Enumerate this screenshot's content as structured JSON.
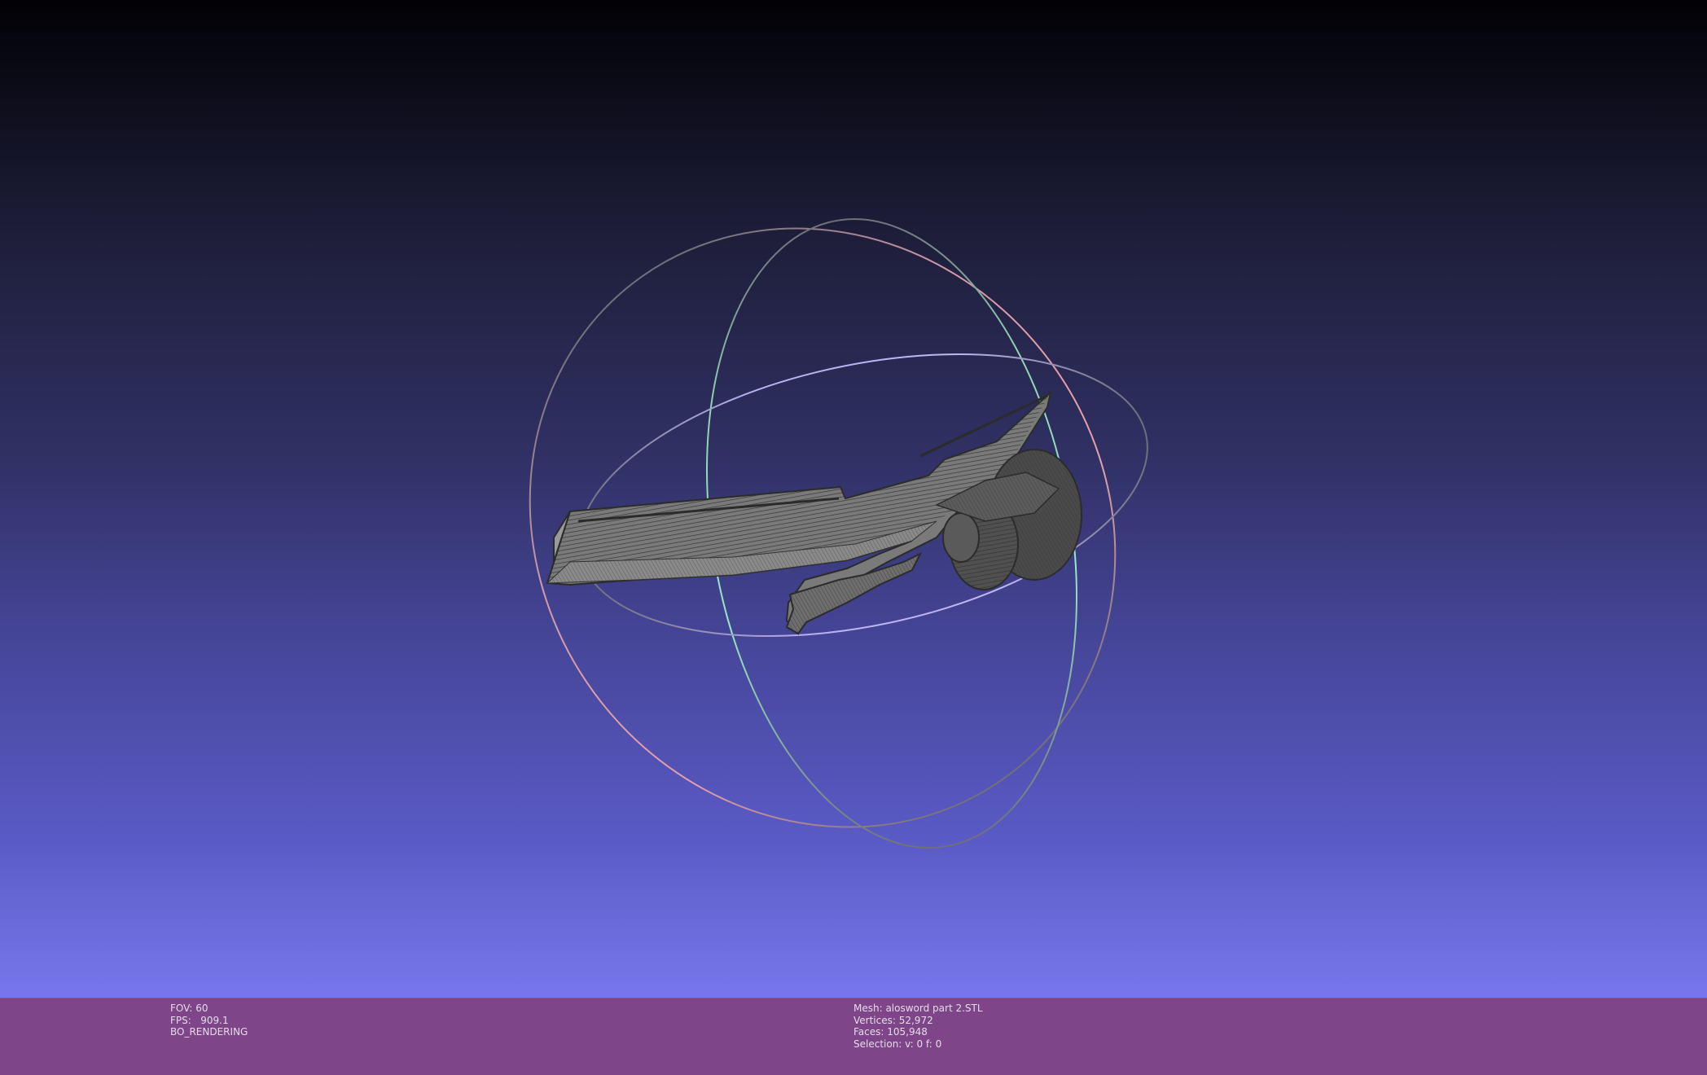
{
  "viewport": {
    "background_top": "#010105",
    "background_bottom": "#7878ee",
    "model_icon": "mesh-model-icon",
    "trackball_icon": "trackball-icon"
  },
  "info_bar": {
    "background": "#7e4688",
    "left": {
      "fov": "FOV: 60",
      "fps": "FPS:   909.1",
      "render_mode": "BO_RENDERING"
    },
    "right": {
      "mesh": "Mesh: alosword part 2.STL",
      "vertices": "Vertices: 52,972",
      "faces": "Faces: 105,948",
      "selection": "Selection: v: 0 f: 0"
    }
  }
}
